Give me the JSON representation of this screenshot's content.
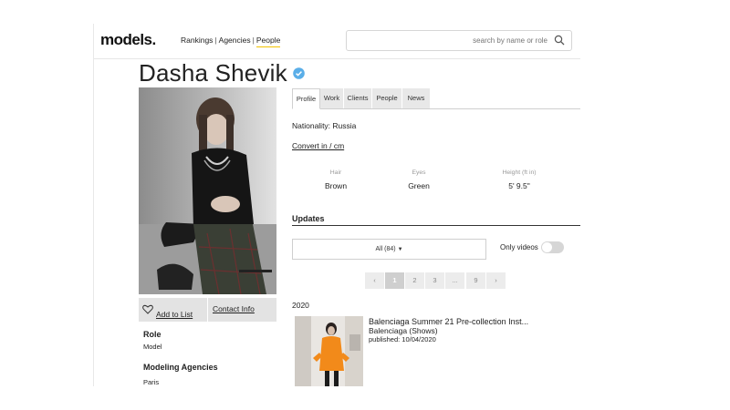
{
  "header": {
    "logo": "models.",
    "nav": [
      "Rankings",
      "Agencies",
      "People"
    ],
    "nav_active": "People",
    "search_placeholder": "search by name or role"
  },
  "profile": {
    "name": "Dasha Shevik",
    "verified": true,
    "add_to_list": "Add to List",
    "contact_info": "Contact Info",
    "role_heading": "Role",
    "role_value": "Model",
    "agencies_heading": "Modeling Agencies",
    "agencies_value": "Paris"
  },
  "tabs": [
    "Profile",
    "Work",
    "Clients",
    "People",
    "News"
  ],
  "details": {
    "nationality": "Nationality: Russia",
    "convert": "Convert in / cm",
    "stats": [
      {
        "label": "Hair",
        "value": "Brown"
      },
      {
        "label": "Eyes",
        "value": "Green"
      },
      {
        "label": "Height (ft in)",
        "value": "5' 9.5\""
      }
    ]
  },
  "updates": {
    "heading": "Updates",
    "filter": "All (84)",
    "only_videos": "Only videos",
    "only_videos_on": false,
    "pagination": [
      "‹",
      "1",
      "2",
      "3",
      "...",
      "9",
      "›"
    ],
    "current_page": "1",
    "year": "2020",
    "items": [
      {
        "title": "Balenciaga Summer 21 Pre-collection Inst...",
        "subtitle": "Balenciaga (Shows)",
        "date": "published: 10/04/2020"
      }
    ]
  },
  "colors": {
    "accent_underline": "#f2c200",
    "verified_blue": "#5aaee8",
    "button_gray": "#e3e3e3"
  }
}
